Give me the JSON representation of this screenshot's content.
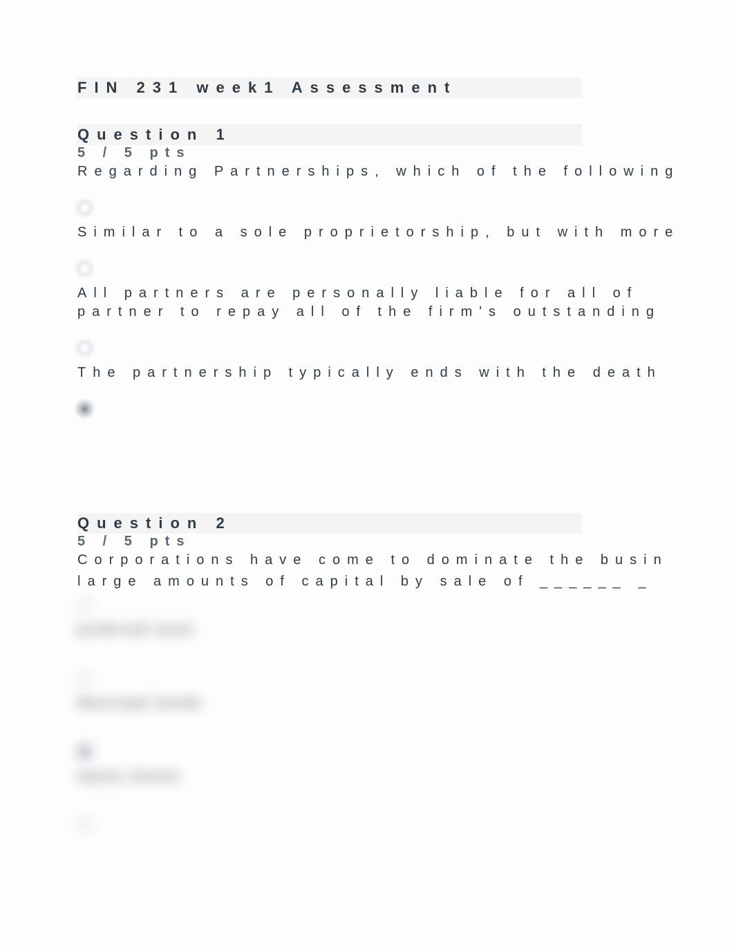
{
  "title": "FIN 231 week1 Assessment",
  "q1": {
    "heading": "Question 1",
    "points": "5 / 5 pts",
    "prompt": "Regarding Partnerships, which of the following",
    "options": [
      "Similar to a sole proprietorship, but with more",
      "All partners are personally liable for all of",
      "partner to repay all of the firm's outstanding",
      "The partnership typically ends with the death"
    ]
  },
  "q2": {
    "heading": "Question 2",
    "points": "5 / 5 pts",
    "prompt_l1": "Corporations have come to dominate the busin",
    "prompt_l2": "large amounts of capital by sale of ______ _",
    "options": [
      "preferred stock",
      "Municipal bonds",
      "equity shares",
      ""
    ]
  }
}
